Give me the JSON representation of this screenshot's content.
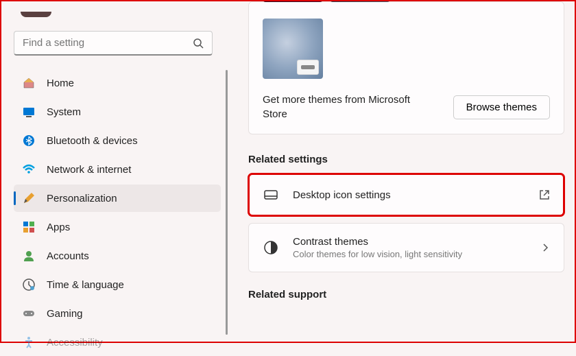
{
  "search": {
    "placeholder": "Find a setting"
  },
  "nav": {
    "items": [
      {
        "label": "Home"
      },
      {
        "label": "System"
      },
      {
        "label": "Bluetooth & devices"
      },
      {
        "label": "Network & internet"
      },
      {
        "label": "Personalization"
      },
      {
        "label": "Apps"
      },
      {
        "label": "Accounts"
      },
      {
        "label": "Time & language"
      },
      {
        "label": "Gaming"
      },
      {
        "label": "Accessibility"
      }
    ]
  },
  "themes": {
    "more_text": "Get more themes from Microsoft Store",
    "browse_label": "Browse themes"
  },
  "related_settings": {
    "heading": "Related settings",
    "items": [
      {
        "title": "Desktop icon settings",
        "subtitle": ""
      },
      {
        "title": "Contrast themes",
        "subtitle": "Color themes for low vision, light sensitivity"
      }
    ]
  },
  "related_support": {
    "heading": "Related support"
  }
}
